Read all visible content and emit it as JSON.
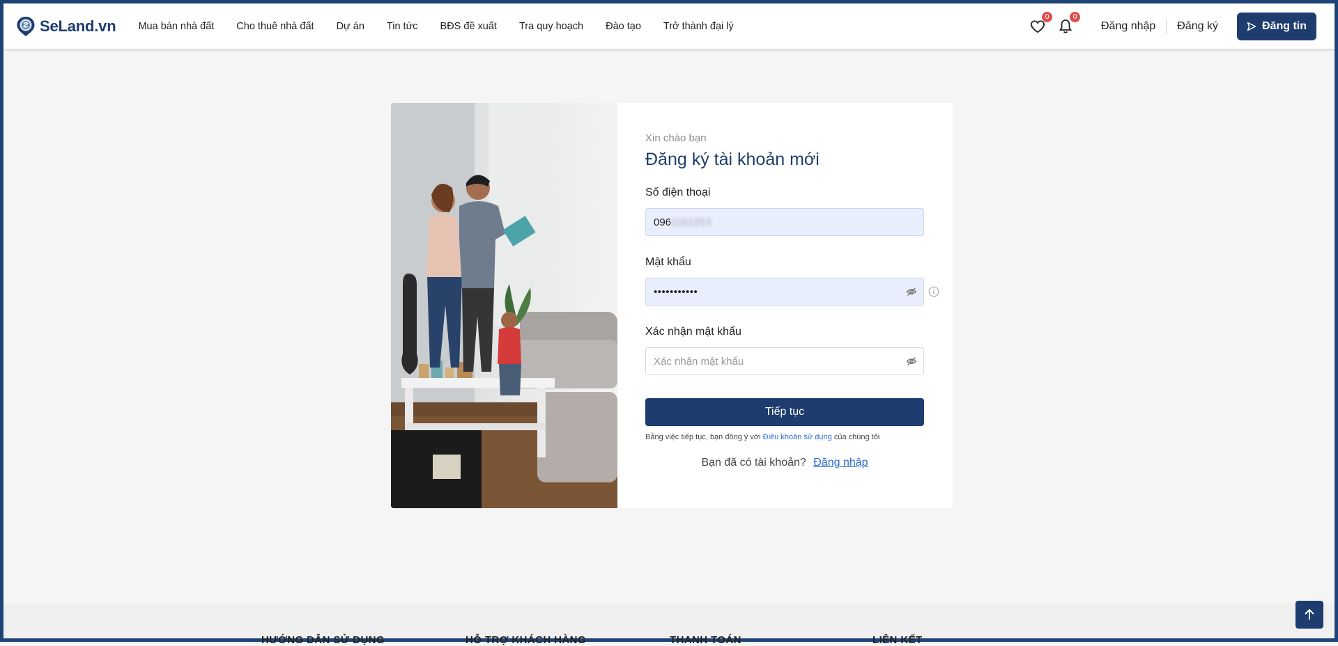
{
  "brand": {
    "name": "SeLand.vn"
  },
  "nav": [
    "Mua bán nhà đất",
    "Cho thuê nhà đất",
    "Dự án",
    "Tin tức",
    "BĐS đề xuất",
    "Tra quy hoạch",
    "Đào tạo",
    "Trở thành đại lý"
  ],
  "header": {
    "favorites_count": "0",
    "notifications_count": "0",
    "login": "Đăng nhập",
    "register": "Đăng ký",
    "post_button": "Đăng tin",
    "favorites_icon": "heart-icon",
    "notifications_icon": "bell-icon",
    "post_icon": "send-icon"
  },
  "form": {
    "greeting": "Xin chào bạn",
    "title": "Đăng ký tài khoản mới",
    "phone_label": "Số điện thoại",
    "phone_value_prefix": "096",
    "phone_value_hidden": "1161253",
    "password_label": "Mật khẩu",
    "password_value": "•••••••••••",
    "confirm_label": "Xác nhận mật khẩu",
    "confirm_placeholder": "Xác nhận mật khẩu",
    "submit": "Tiếp tục",
    "terms_prefix": "Bằng việc tiếp tục, bạn đồng ý với",
    "terms_link": "Điều khoản sử dụng",
    "terms_suffix": "của chúng tôi",
    "have_account": "Bạn đã có tài khoản?",
    "login_link": "Đăng nhập"
  },
  "footer": {
    "columns": [
      "HƯỚNG DẪN SỬ DỤNG",
      "HỖ TRỢ KHÁCH HÀNG",
      "THANH TOÁN",
      "LIÊN KẾT"
    ]
  },
  "colors": {
    "primary": "#1e3d6e",
    "badge": "#e44b4b",
    "link": "#2a6ad6",
    "input_filled": "#e8eefb",
    "page_bg": "#f5f5f6"
  }
}
